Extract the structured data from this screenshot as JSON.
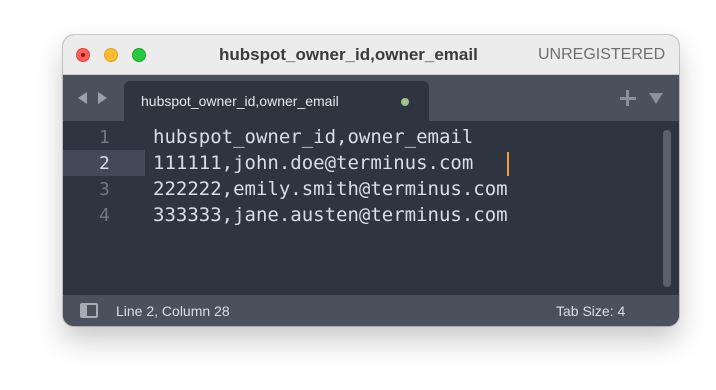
{
  "window": {
    "title": "hubspot_owner_id,owner_email",
    "license": "UNREGISTERED"
  },
  "tabs": [
    {
      "label": "hubspot_owner_id,owner_email",
      "modified": true
    }
  ],
  "editor": {
    "lines": [
      {
        "number": "1",
        "text": "hubspot_owner_id,owner_email"
      },
      {
        "number": "2",
        "text": "111111,john.doe@terminus.com"
      },
      {
        "number": "3",
        "text": "222222,emily.smith@terminus.com"
      },
      {
        "number": "4",
        "text": "333333,jane.austen@terminus.com"
      }
    ],
    "active_line": 2
  },
  "status": {
    "position": "Line 2, Column 28",
    "tab_size": "Tab Size: 4"
  },
  "colors": {
    "editor_bg": "#2e3440",
    "chrome_bg": "#4b515c",
    "caret": "#f0a040",
    "modified_dot": "#a3be8c"
  },
  "icons": {
    "close": "close-button",
    "minimize": "minimize-button",
    "maximize": "zoom-button",
    "nav_back": "chevron-left-icon",
    "nav_forward": "chevron-right-icon",
    "new_tab": "plus-icon",
    "tab_menu": "triangle-down-icon",
    "toggle_panel": "panel-icon"
  }
}
